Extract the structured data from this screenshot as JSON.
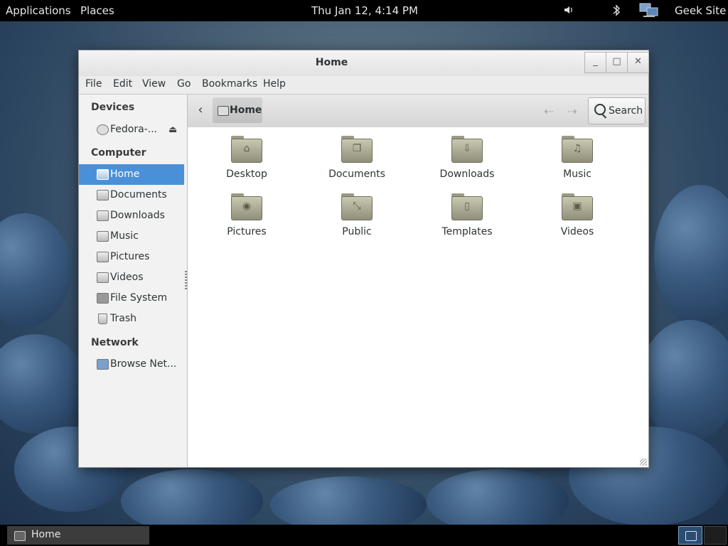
{
  "top_panel": {
    "applications": "Applications",
    "places": "Places",
    "clock": "Thu Jan 12,  4:14 PM",
    "user": "Geek Site",
    "icons": [
      "volume-icon",
      "bluetooth-icon",
      "network-icon"
    ]
  },
  "window": {
    "title": "Home",
    "controls": {
      "minimize": "_",
      "maximize": "□",
      "close": "✕"
    },
    "menu": [
      "File",
      "Edit",
      "View",
      "Go",
      "Bookmarks",
      "Help"
    ]
  },
  "sidebar": {
    "devices_heading": "Devices",
    "devices": [
      {
        "label": "Fedora-...",
        "icon": "disc-icon"
      }
    ],
    "computer_heading": "Computer",
    "computer": [
      {
        "label": "Home",
        "icon": "home-folder-icon"
      },
      {
        "label": "Documents",
        "icon": "documents-folder-icon"
      },
      {
        "label": "Downloads",
        "icon": "downloads-folder-icon"
      },
      {
        "label": "Music",
        "icon": "music-folder-icon"
      },
      {
        "label": "Pictures",
        "icon": "pictures-folder-icon"
      },
      {
        "label": "Videos",
        "icon": "videos-folder-icon"
      },
      {
        "label": "File System",
        "icon": "drive-icon"
      },
      {
        "label": "Trash",
        "icon": "trash-icon"
      }
    ],
    "network_heading": "Network",
    "network": [
      {
        "label": "Browse Net...",
        "icon": "network-icon"
      }
    ]
  },
  "toolbar": {
    "path": "Home",
    "search": "Search"
  },
  "folders": [
    {
      "label": "Desktop",
      "icon": "desktop-folder-icon"
    },
    {
      "label": "Documents",
      "icon": "documents-folder-icon"
    },
    {
      "label": "Downloads",
      "icon": "downloads-folder-icon"
    },
    {
      "label": "Music",
      "icon": "music-folder-icon"
    },
    {
      "label": "Pictures",
      "icon": "pictures-folder-icon"
    },
    {
      "label": "Public",
      "icon": "public-folder-icon"
    },
    {
      "label": "Templates",
      "icon": "templates-folder-icon"
    },
    {
      "label": "Videos",
      "icon": "videos-folder-icon"
    }
  ],
  "taskbar": {
    "task": "Home"
  },
  "colors": {
    "selection": "#4a90d9",
    "panel": "#000000",
    "folder": "#b9b9a2"
  }
}
